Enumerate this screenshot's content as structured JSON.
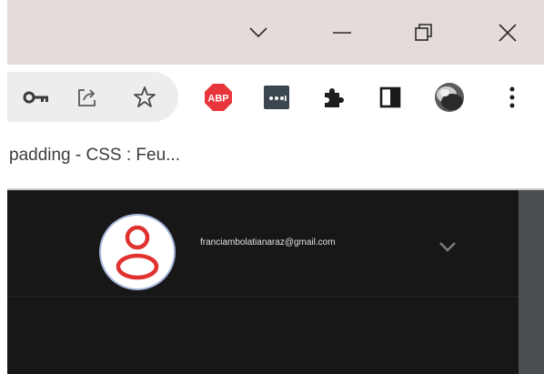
{
  "window": {
    "controls": [
      "tab-search",
      "minimize",
      "restore",
      "close"
    ]
  },
  "toolbar": {
    "icons": [
      "key-icon",
      "share-icon",
      "star-icon",
      "adblock-plus-icon",
      "password-manager-icon",
      "extensions-puzzle-icon",
      "side-panel-icon",
      "profile-avatar",
      "kebab-menu-icon"
    ],
    "abp_label": "ABP",
    "abp_color": "#e8353b"
  },
  "bookmarks": {
    "items": [
      {
        "label": "padding - CSS : Feu..."
      }
    ]
  },
  "page": {
    "account": {
      "email": "franciambolatianaraz@gmail.com",
      "avatar_color": "#e0322f"
    }
  }
}
